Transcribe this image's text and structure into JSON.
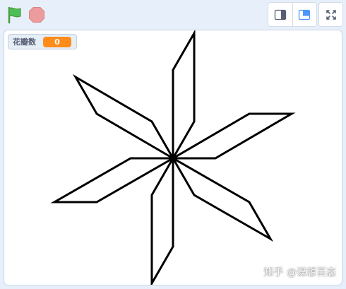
{
  "toolbar": {
    "green_flag_icon": "green-flag-icon",
    "stop_icon": "stop-sign-icon",
    "colors": {
      "flag": "#4cbf56",
      "stop": "#ec9c9c",
      "accent": "#4c97ff"
    }
  },
  "stage": {
    "background": "#ffffff",
    "monitor": {
      "label": "花瓣数",
      "value": "0",
      "value_color": "#ff8c1a"
    },
    "drawing": {
      "shape": "six rhombus petals around a center",
      "petal_count": 6,
      "stroke_color": "#000000"
    },
    "watermark": "知乎 @谋想百态"
  }
}
